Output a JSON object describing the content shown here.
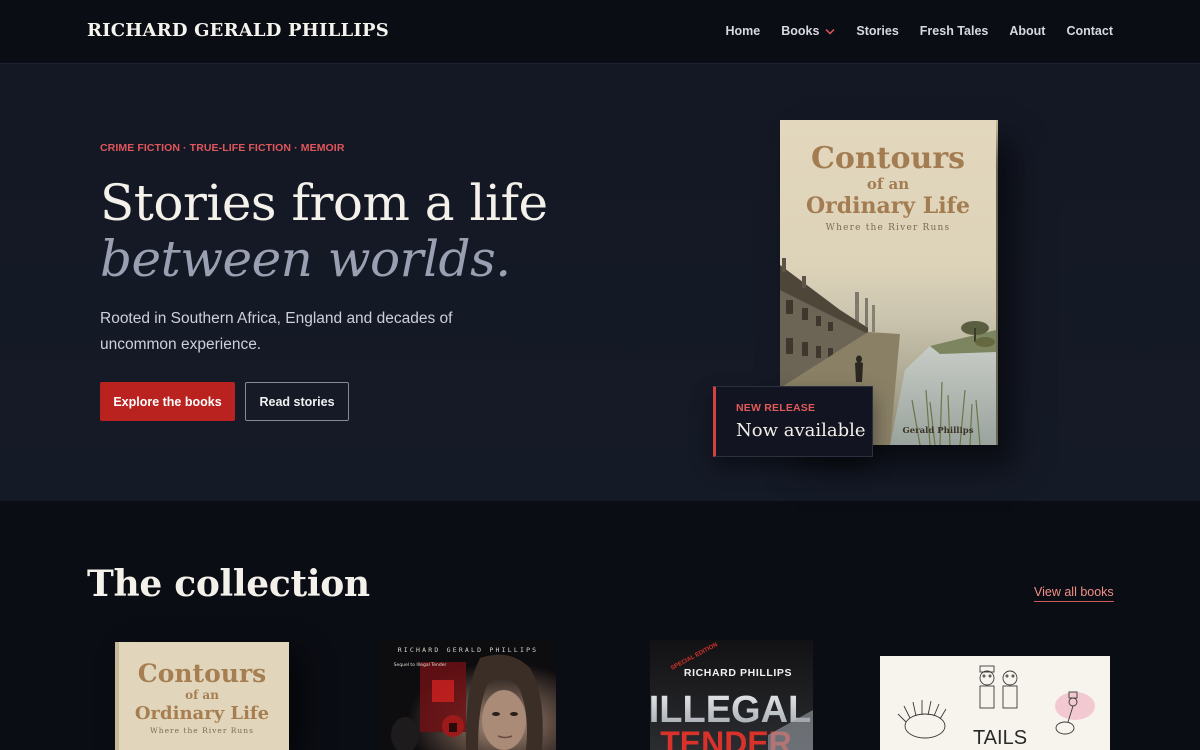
{
  "header": {
    "brand": "RICHARD GERALD PHILLIPS",
    "nav": [
      {
        "label": "Home"
      },
      {
        "label": "Books"
      },
      {
        "label": "Stories"
      },
      {
        "label": "Fresh Tales"
      },
      {
        "label": "About"
      },
      {
        "label": "Contact"
      }
    ],
    "dropdown_icon": "chevron-down-icon"
  },
  "hero": {
    "eyebrow": "CRIME FICTION · TRUE-LIFE FICTION · MEMOIR",
    "headline": "Stories from a life",
    "headline_italic": "between worlds.",
    "lede": "Rooted in Southern Africa, England and decades of uncommon experience.",
    "primary_cta": "Explore the books",
    "secondary_cta": "Read stories",
    "book": {
      "title_line1": "Contours",
      "title_line2": "of an",
      "title_line3": "Ordinary Life",
      "subtitle": "Where the River Runs",
      "author": "Gerald Phillips"
    },
    "release_badge": {
      "label": "NEW RELEASE",
      "title": "Now available"
    }
  },
  "collection": {
    "title": "The collection",
    "view_all": "View all books",
    "books": [
      {
        "title_line1": "Contours",
        "title_line2": "of an",
        "title_line3": "Ordinary Life",
        "subtitle": "Where the River Runs"
      },
      {
        "author": "RICHARD GERALD PHILLIPS",
        "line1": "Sequel to Illegal Tender"
      },
      {
        "badge": "SPECIAL EDITION",
        "author": "RICHARD PHILLIPS",
        "title_line1": "ILLEGAL",
        "title_line2": "TENDER"
      },
      {
        "title": "TAILS"
      }
    ]
  },
  "colors": {
    "accent": "#b9221f",
    "accent_text": "#e0565b",
    "background": "#0b0d14",
    "hero_background": "#151a27"
  }
}
